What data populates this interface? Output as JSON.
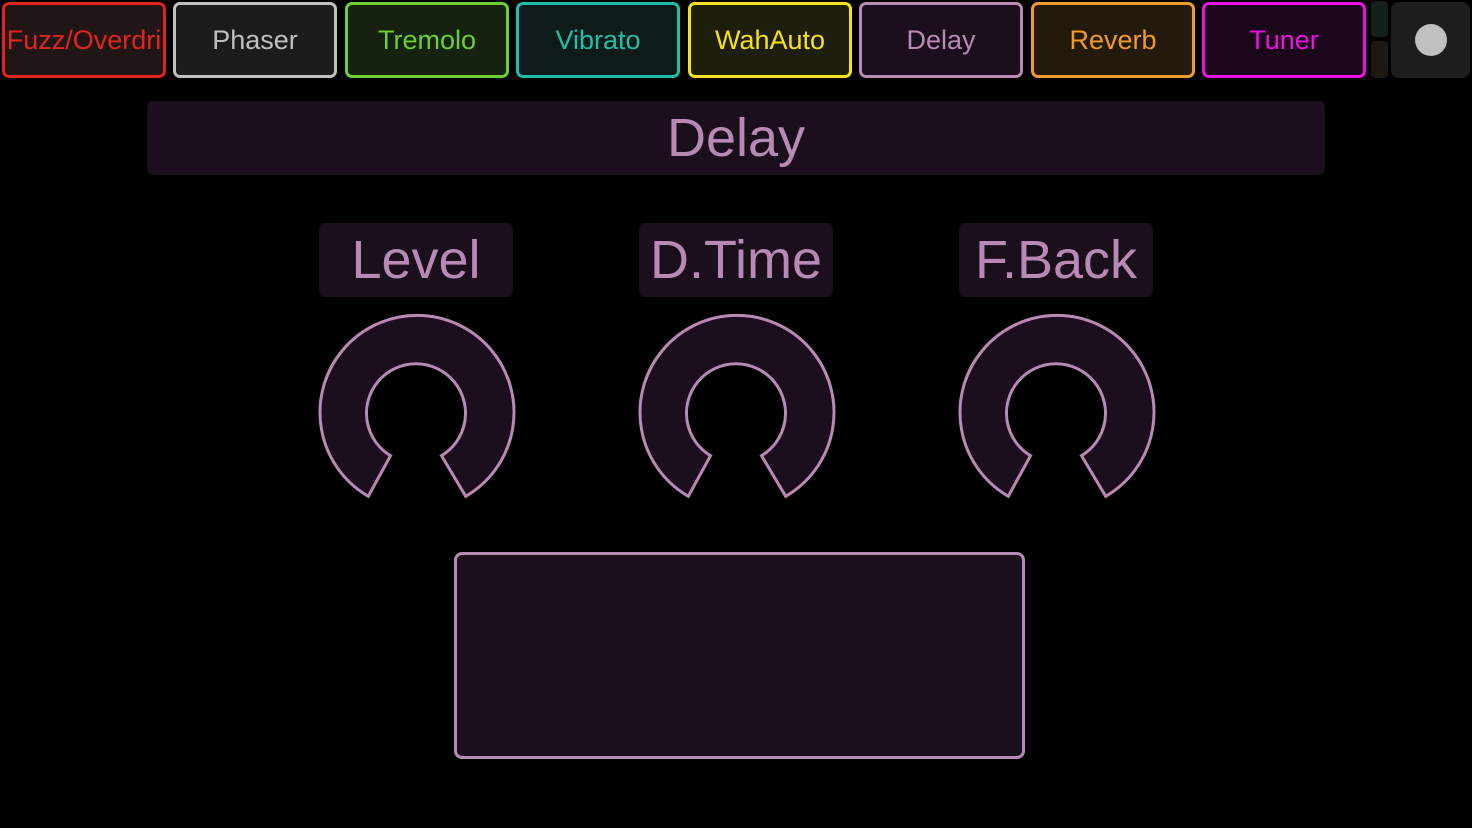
{
  "colors": {
    "background": "#000000",
    "accent": "#b78ab4",
    "panel": "#1c0f1d"
  },
  "tabs": [
    {
      "label": "Fuzz/Overdri",
      "color": "#e0251e",
      "bg": "#201616",
      "active": false
    },
    {
      "label": "Phaser",
      "color": "#c0c0c0",
      "bg": "#1c1c1c",
      "active": false
    },
    {
      "label": "Tremolo",
      "color": "#6ccf35",
      "bg": "#17210f",
      "active": false
    },
    {
      "label": "Vibrato",
      "color": "#1ebfa6",
      "bg": "#0f1a1b",
      "active": false
    },
    {
      "label": "WahAuto",
      "color": "#f4e21c",
      "bg": "#1f1d0c",
      "active": false
    },
    {
      "label": "Delay",
      "color": "#b78ab4",
      "bg": "#1c0f1d",
      "active": true
    },
    {
      "label": "Reverb",
      "color": "#f09a2a",
      "bg": "#231a0c",
      "active": false
    },
    {
      "label": "Tuner",
      "color": "#ee10e0",
      "bg": "#1c061c",
      "active": false
    }
  ],
  "power": {
    "icon": "power-dot-icon"
  },
  "effect_title": "Delay",
  "knobs": [
    {
      "label": "Level",
      "value": 0
    },
    {
      "label": "D.Time",
      "value": 0
    },
    {
      "label": "F.Back",
      "value": 0
    }
  ]
}
